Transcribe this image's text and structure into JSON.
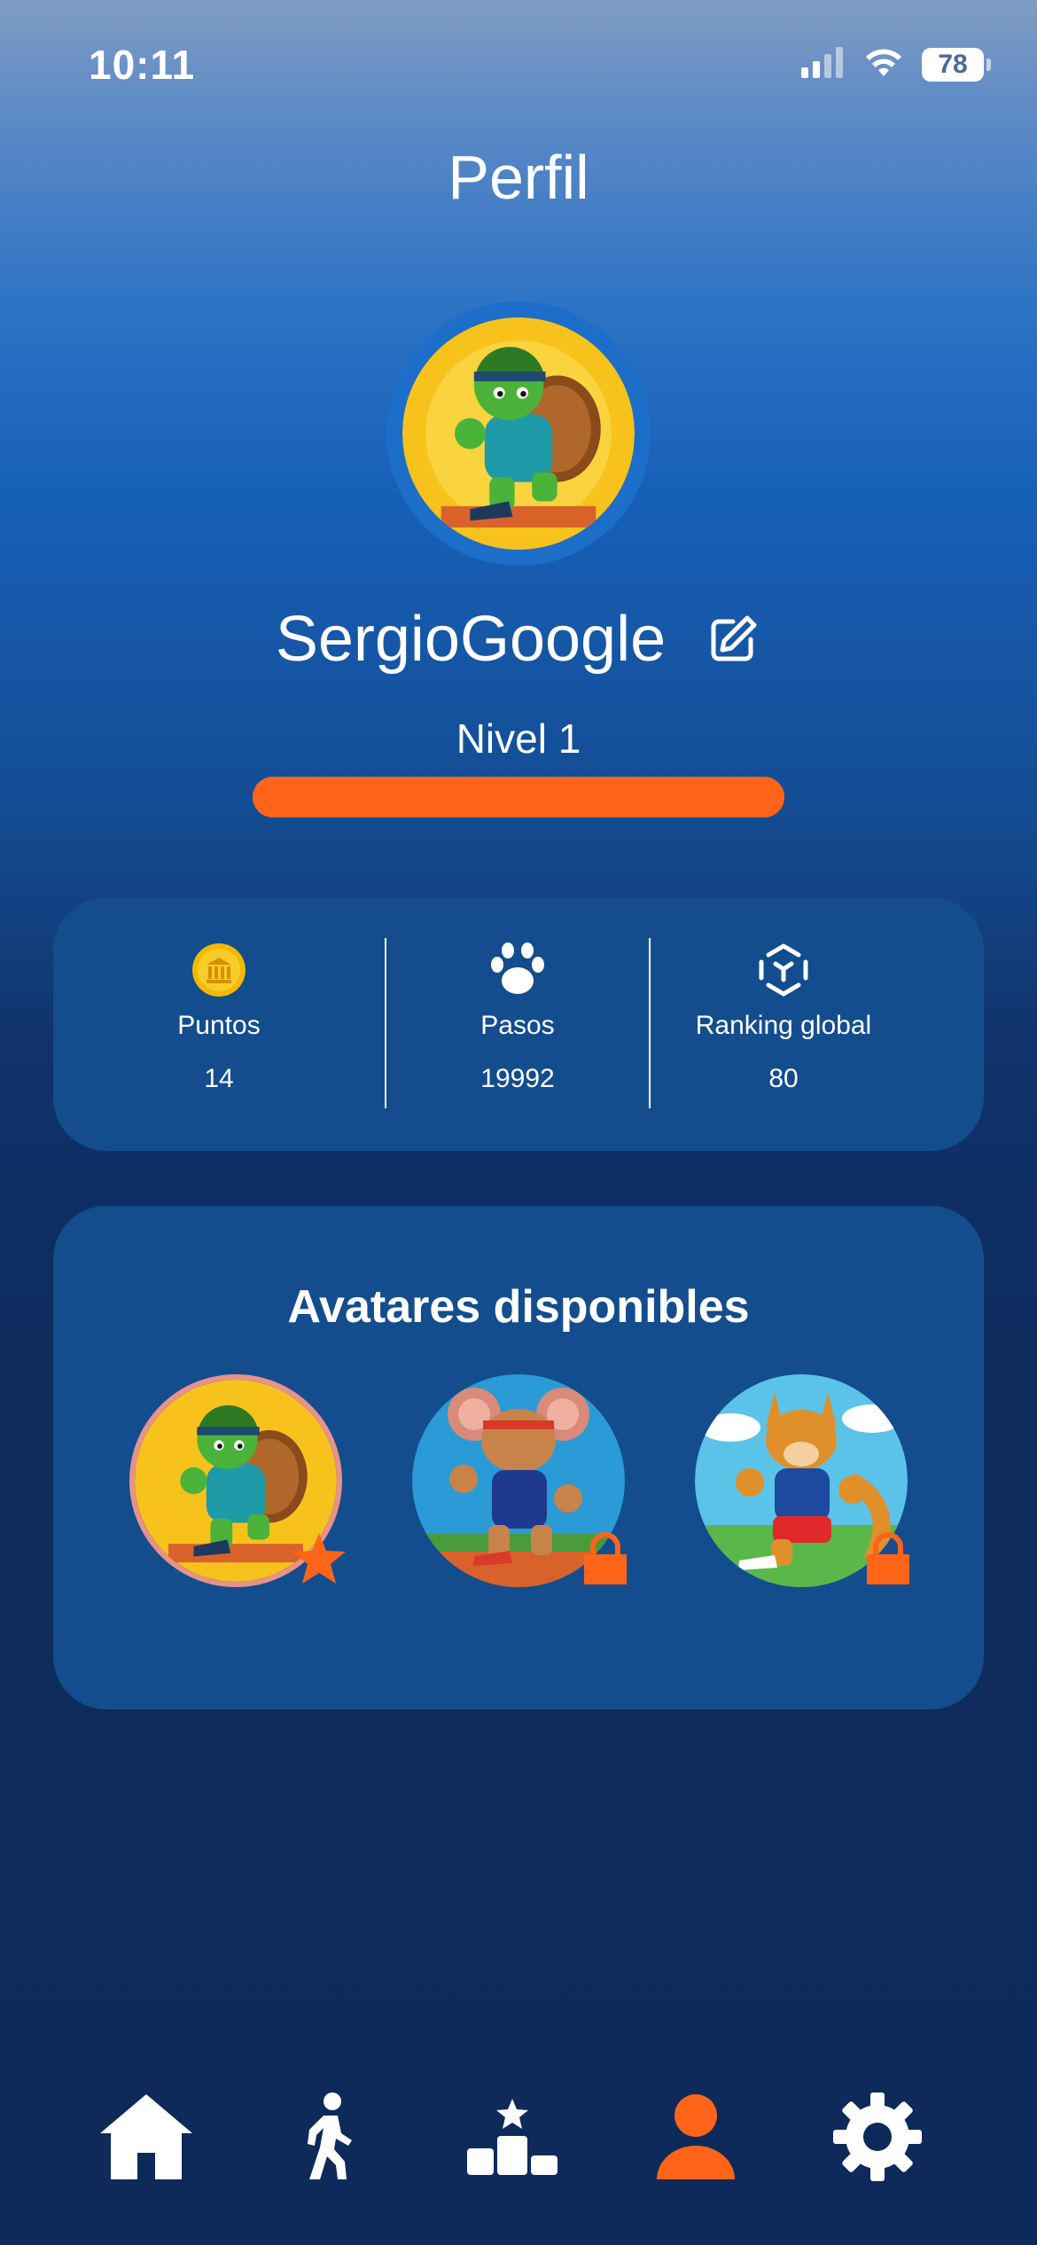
{
  "status_bar": {
    "time": "10:11",
    "battery": "78"
  },
  "page": {
    "title": "Perfil"
  },
  "profile": {
    "username": "SergioGoogle",
    "level_label": "Nivel 1",
    "level_progress_percent": 100
  },
  "stats": [
    {
      "icon": "coin-icon",
      "label": "Puntos",
      "value": "14"
    },
    {
      "icon": "paw-icon",
      "label": "Pasos",
      "value": "19992"
    },
    {
      "icon": "ranking-icon",
      "label": "Ranking global",
      "value": "80"
    }
  ],
  "avatars": {
    "title": "Avatares disponibles",
    "items": [
      {
        "name": "turtle-runner",
        "state": "selected"
      },
      {
        "name": "mouse-runner",
        "state": "locked"
      },
      {
        "name": "kangaroo-runner",
        "state": "locked"
      }
    ]
  },
  "nav": {
    "items": [
      {
        "icon": "home-icon",
        "active": false
      },
      {
        "icon": "walking-icon",
        "active": false
      },
      {
        "icon": "podium-icon",
        "active": false
      },
      {
        "icon": "profile-icon",
        "active": true
      },
      {
        "icon": "gear-icon",
        "active": false
      }
    ]
  },
  "colors": {
    "accent": "#ff6419",
    "card_bg": "#134d8e",
    "background_dark": "#0d2a5a",
    "nav_inactive": "#ffffff"
  }
}
